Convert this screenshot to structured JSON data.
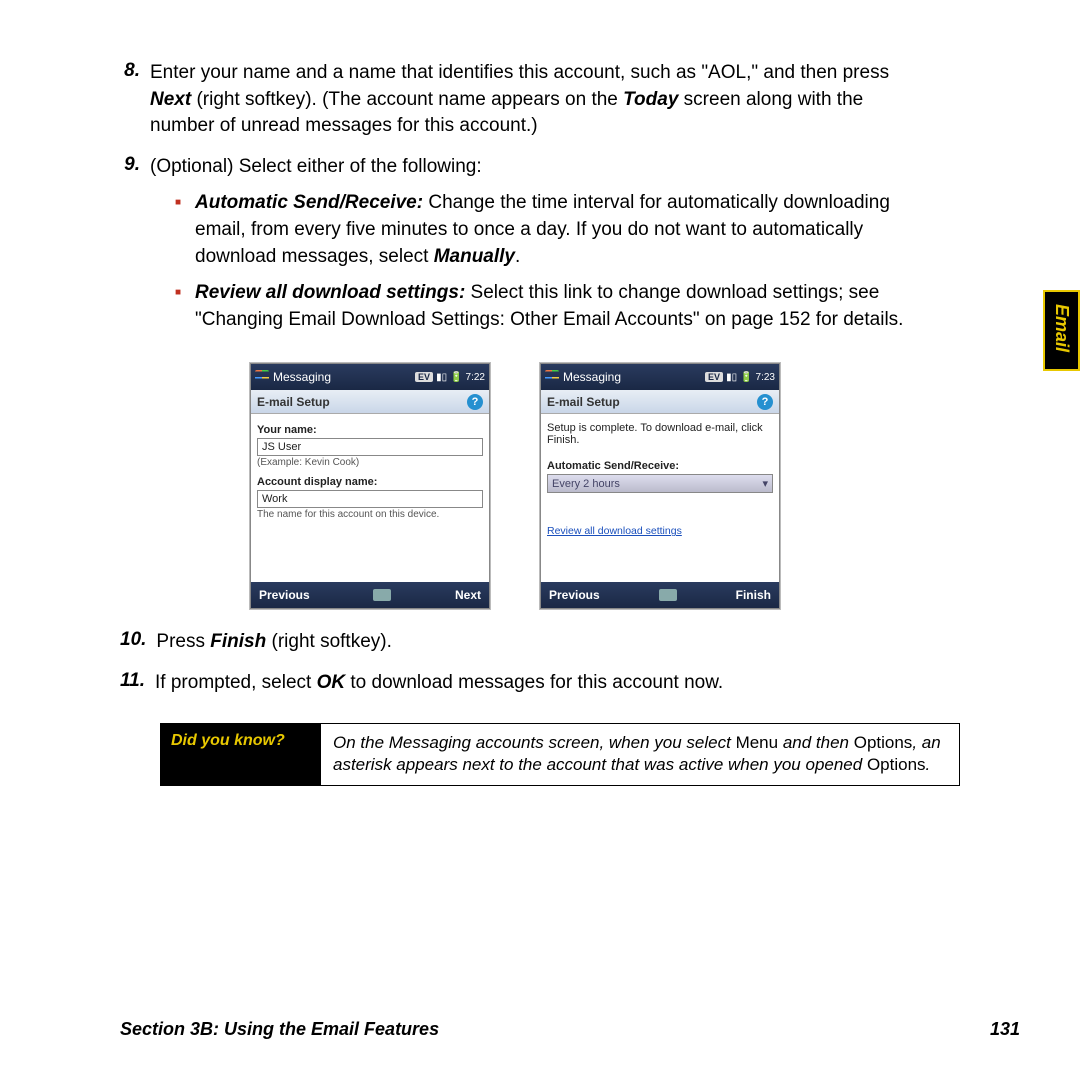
{
  "sideTab": "Email",
  "items": {
    "i8": {
      "num": "8.",
      "text_a": "Enter your name and a name that identifies this account, such as \"AOL,\" and then press ",
      "next": "Next",
      "text_b": " (right softkey). (The account name appears on the ",
      "today": "Today",
      "text_c": " screen along with the number of unread messages for this account.)"
    },
    "i9": {
      "num": "9.",
      "text": "(Optional) Select either of the following:"
    },
    "sub1": {
      "lead": "Automatic Send/Receive:",
      "text": " Change the time interval for automatically downloading email, from every five minutes to once a day. If you do not want to automatically download messages, select ",
      "manually": "Manually",
      "dot": "."
    },
    "sub2": {
      "lead": "Review all download settings:",
      "text": " Select this link to change download settings; see \"Changing Email Download Settings: Other Email Accounts\" on page 152 for details."
    },
    "i10": {
      "num": "10.",
      "text_a": "Press ",
      "finish": "Finish",
      "text_b": " (right softkey)."
    },
    "i11": {
      "num": "11.",
      "text_a": "If prompted, select ",
      "ok": "OK",
      "text_b": " to download messages for this account now."
    }
  },
  "screen1": {
    "title": "Messaging",
    "ev": "EV",
    "time": "7:22",
    "sub": "E-mail Setup",
    "yourname_label": "Your name:",
    "yourname_value": "JS User",
    "yourname_hint": "(Example: Kevin Cook)",
    "acct_label": "Account display name:",
    "acct_value": "Work",
    "acct_hint": "The name for this account on this device.",
    "prev": "Previous",
    "next": "Next"
  },
  "screen2": {
    "title": "Messaging",
    "ev": "EV",
    "time": "7:23",
    "sub": "E-mail Setup",
    "complete": "Setup is complete.  To download e-mail, click Finish.",
    "asr_label": "Automatic Send/Receive:",
    "asr_value": "Every 2 hours",
    "review_link": "Review all download settings",
    "prev": "Previous",
    "finish": "Finish"
  },
  "dyk": {
    "label": "Did you know?",
    "t1": "On the Messaging accounts screen, when you select ",
    "menu": "Menu",
    "t2": " and then ",
    "options1": "Options",
    "t3": ", an asterisk appears next to the account that was active when you opened ",
    "options2": "Options",
    "t4": "."
  },
  "footer": {
    "section": "Section 3B: Using the Email Features",
    "page": "131"
  }
}
